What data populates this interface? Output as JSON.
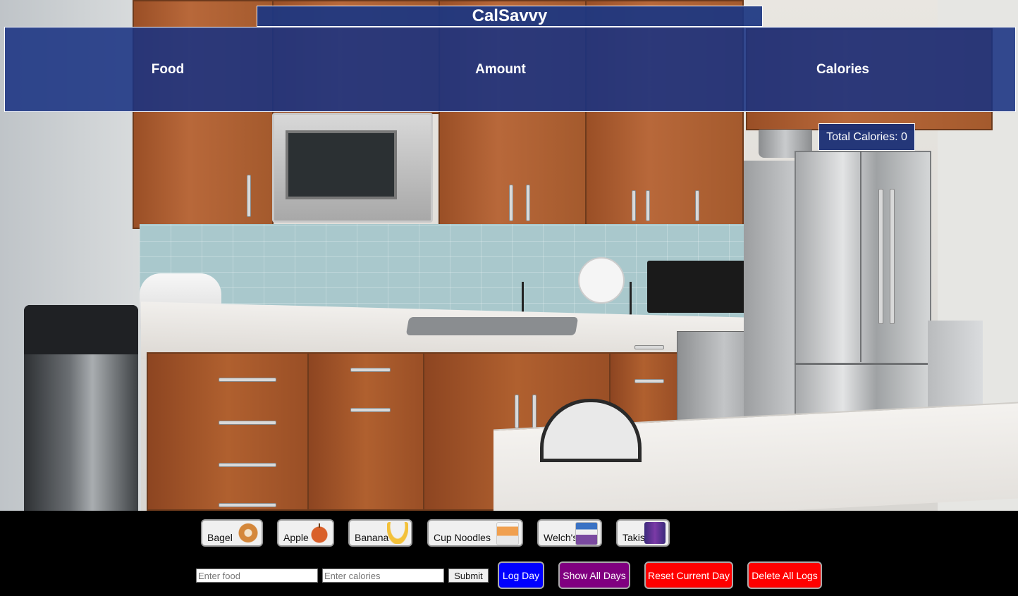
{
  "app": {
    "title": "CalSavvy"
  },
  "log_table": {
    "columns": [
      "Food",
      "Amount",
      "Calories"
    ]
  },
  "total": {
    "label": "Total Calories: 0",
    "value": 0
  },
  "quick_foods": [
    {
      "label": "Bagel",
      "icon": "bagel-icon"
    },
    {
      "label": "Apple",
      "icon": "apple-icon"
    },
    {
      "label": "Banana",
      "icon": "banana-icon"
    },
    {
      "label": "Cup Noodles",
      "icon": "cup-noodles-icon"
    },
    {
      "label": "Welch's",
      "icon": "welchs-icon"
    },
    {
      "label": "Takis",
      "icon": "takis-icon"
    }
  ],
  "form": {
    "food_placeholder": "Enter food",
    "calories_placeholder": "Enter calories",
    "submit_label": "Submit"
  },
  "actions": [
    {
      "label": "Log Day",
      "color": "#0000ff"
    },
    {
      "label": "Show All Days",
      "color": "#800080"
    },
    {
      "label": "Reset Current Day",
      "color": "#ff0000"
    },
    {
      "label": "Delete All Logs",
      "color": "#ff0000"
    }
  ]
}
